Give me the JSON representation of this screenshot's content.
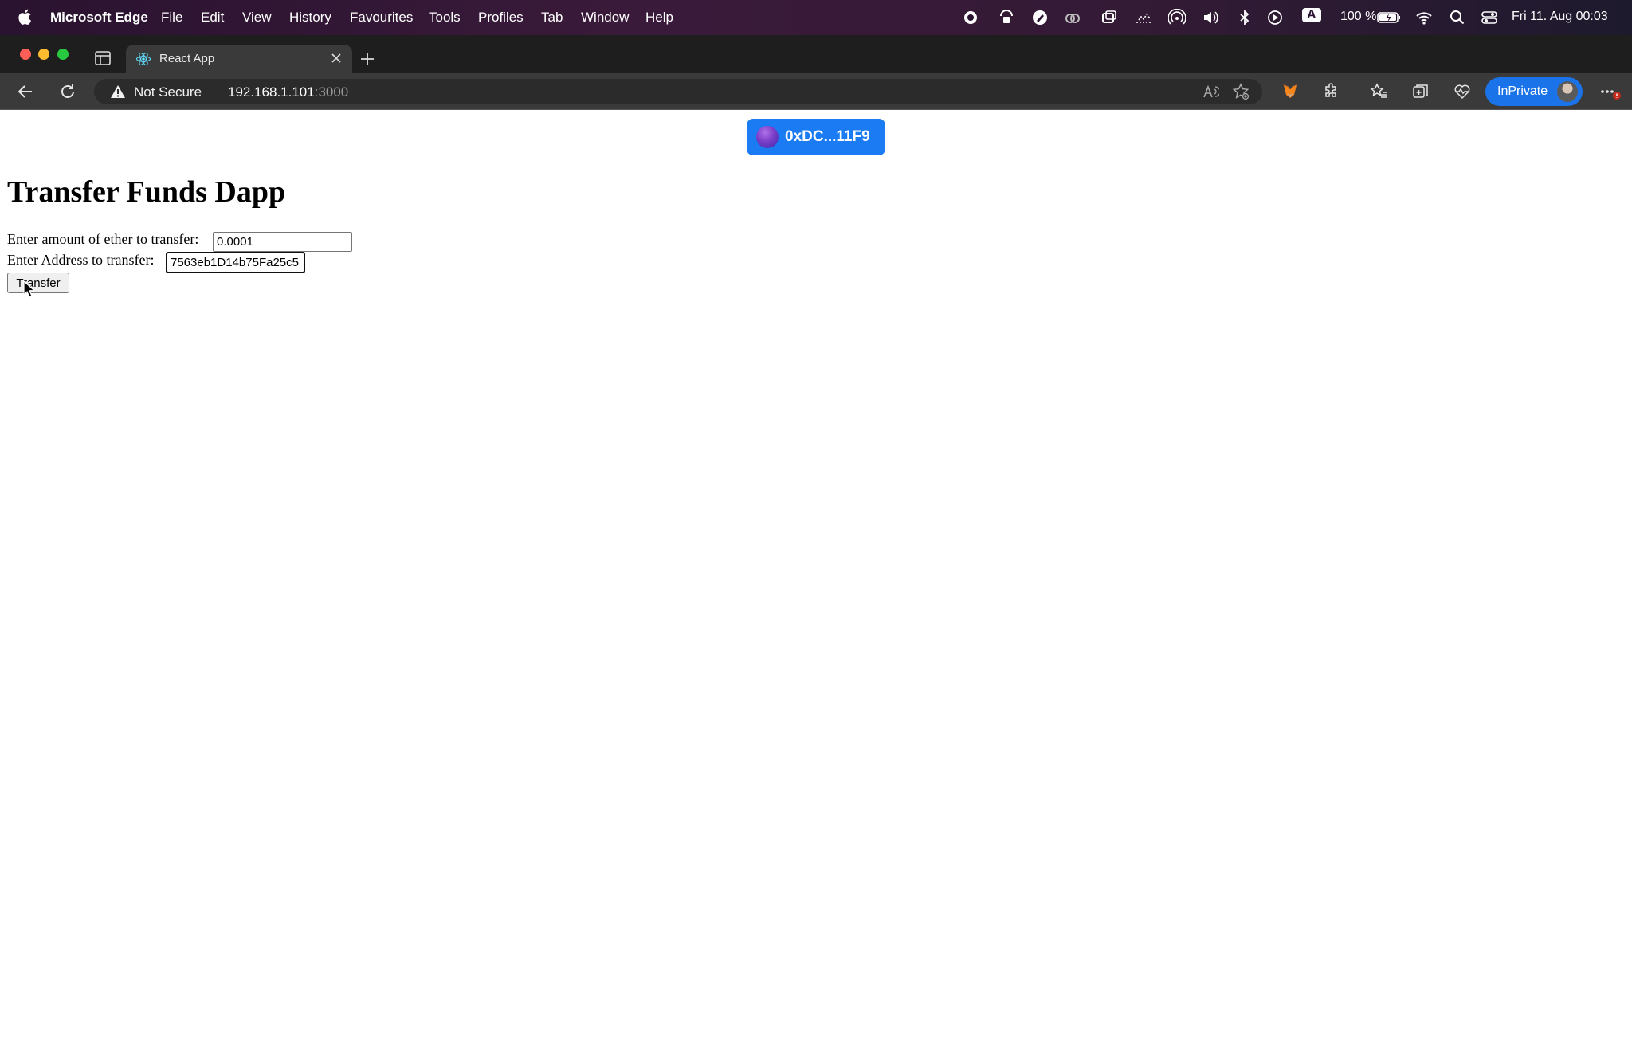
{
  "menubar": {
    "app_name": "Microsoft Edge",
    "items": [
      "File",
      "Edit",
      "View",
      "History",
      "Favourites",
      "Tools",
      "Profiles",
      "Tab",
      "Window",
      "Help"
    ],
    "battery": "100 %",
    "clock": "Fri 11. Aug  00:03",
    "input_source": "A"
  },
  "browser": {
    "tab_title": "React App",
    "security_label": "Not Secure",
    "url_host": "192.168.1.101",
    "url_port": ":3000",
    "inprivate_label": "InPrivate"
  },
  "page": {
    "wallet_address": "0xDC...11F9",
    "title": "Transfer Funds Dapp",
    "amount_label": "Enter amount of ether to transfer:",
    "amount_value": "0.0001",
    "address_label": "Enter Address to transfer:",
    "address_value": "7563eb1D14b75Fa25c5",
    "transfer_button": "Transfer"
  },
  "colors": {
    "wallet_button": "#1a7bf2",
    "inprivate_badge": "#1a73e8"
  }
}
